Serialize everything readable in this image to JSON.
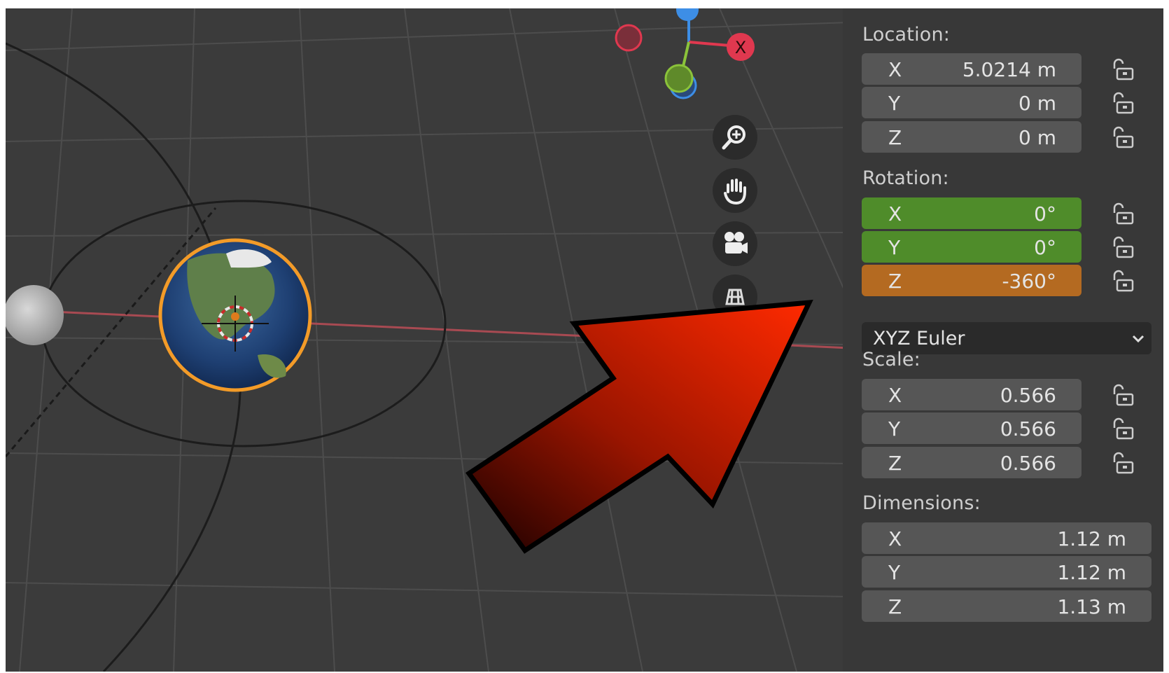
{
  "transform": {
    "location": {
      "label": "Location:",
      "x": {
        "axis": "X",
        "value": "5.0214 m"
      },
      "y": {
        "axis": "Y",
        "value": "0 m"
      },
      "z": {
        "axis": "Z",
        "value": "0 m"
      }
    },
    "rotation": {
      "label": "Rotation:",
      "x": {
        "axis": "X",
        "value": "0°"
      },
      "y": {
        "axis": "Y",
        "value": "0°"
      },
      "z": {
        "axis": "Z",
        "value": "-360°"
      },
      "mode": "XYZ Euler"
    },
    "scale": {
      "label": "Scale:",
      "x": {
        "axis": "X",
        "value": "0.566"
      },
      "y": {
        "axis": "Y",
        "value": "0.566"
      },
      "z": {
        "axis": "Z",
        "value": "0.566"
      }
    },
    "dimensions": {
      "label": "Dimensions:",
      "x": {
        "axis": "X",
        "value": "1.12 m"
      },
      "y": {
        "axis": "Y",
        "value": "1.12 m"
      },
      "z": {
        "axis": "Z",
        "value": "1.13 m"
      }
    }
  },
  "gizmo": {
    "x_label": "X"
  },
  "icons": {
    "zoom": "zoom-in-icon",
    "pan": "hand-pan-icon",
    "camera": "camera-view-icon",
    "ortho": "ortho-grid-icon",
    "lock": "unlock-icon",
    "chevron": "chevron-down-icon"
  },
  "colors": {
    "keyed_green": "#4f8c2a",
    "keyed_orange": "#b46a21",
    "arrow_red": "#e02a00",
    "x_axis": "#e0384f",
    "y_axis": "#8bc33a",
    "z_axis": "#3d8ee6"
  }
}
